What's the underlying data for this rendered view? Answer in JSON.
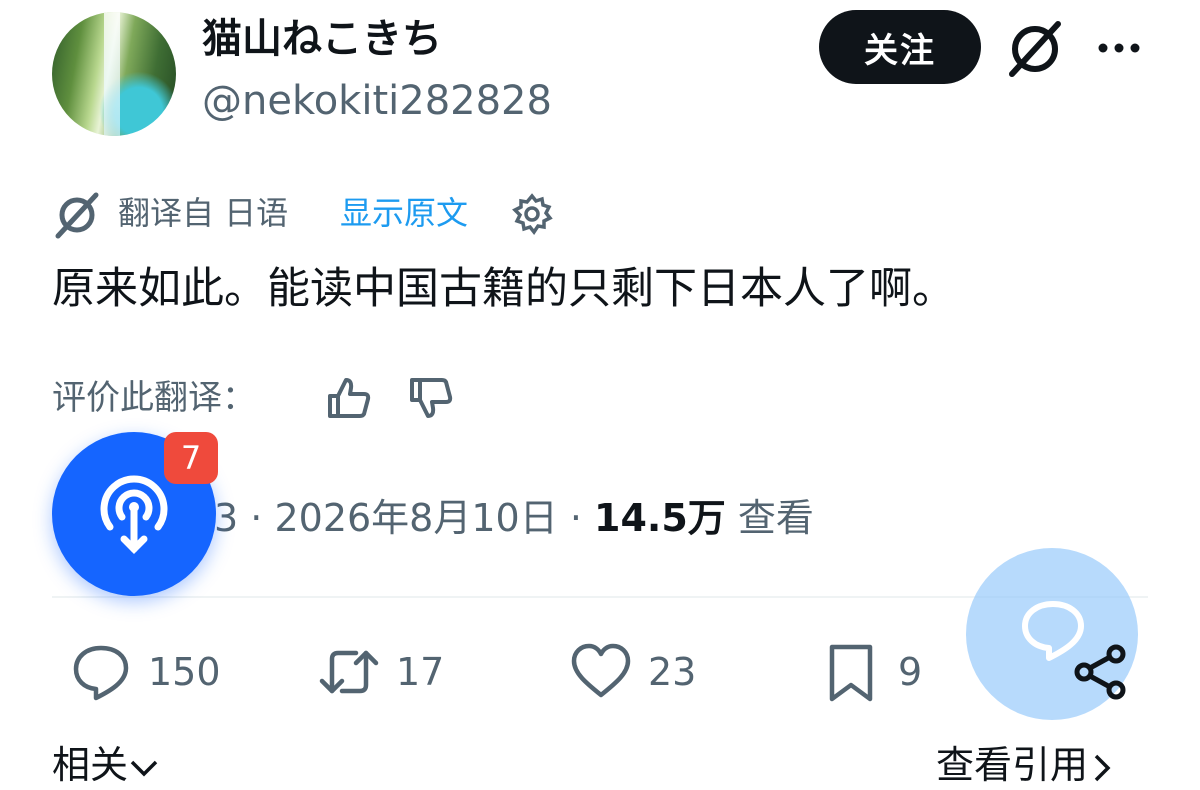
{
  "header": {
    "display_name": "猫山ねこきち",
    "handle": "@nekokiti282828",
    "follow_label": "关注"
  },
  "translation": {
    "from_label": "翻译自 日语",
    "show_original": "显示原文"
  },
  "tweet": {
    "text": "原来如此。能读中国古籍的只剩下日本人了啊。"
  },
  "rating": {
    "label": "评价此翻译："
  },
  "meta": {
    "time_fragment": "3",
    "date": "2026年8月10日",
    "views": "14.5万",
    "views_label": "查看"
  },
  "actions": {
    "replies": "150",
    "reposts": "17",
    "likes": "23",
    "bookmarks": "9"
  },
  "bottom": {
    "related": "相关",
    "view_quotes": "查看引用"
  },
  "overlays": {
    "badge_count": "7"
  },
  "colors": {
    "accent": "#1d9bf0",
    "text": "#0f1419",
    "secondary": "#536471",
    "fab_blue": "#1565ff",
    "badge_red": "#ef4a3c"
  },
  "icons": [
    "grok-icon",
    "more-icon",
    "translate-icon",
    "settings-icon",
    "thumbs-up-icon",
    "thumbs-down-icon",
    "reply-icon",
    "repost-icon",
    "like-icon",
    "bookmark-icon",
    "chevron-down-icon",
    "chevron-right-icon",
    "podcast-icon",
    "chat-bubble-icon",
    "share-icon"
  ]
}
